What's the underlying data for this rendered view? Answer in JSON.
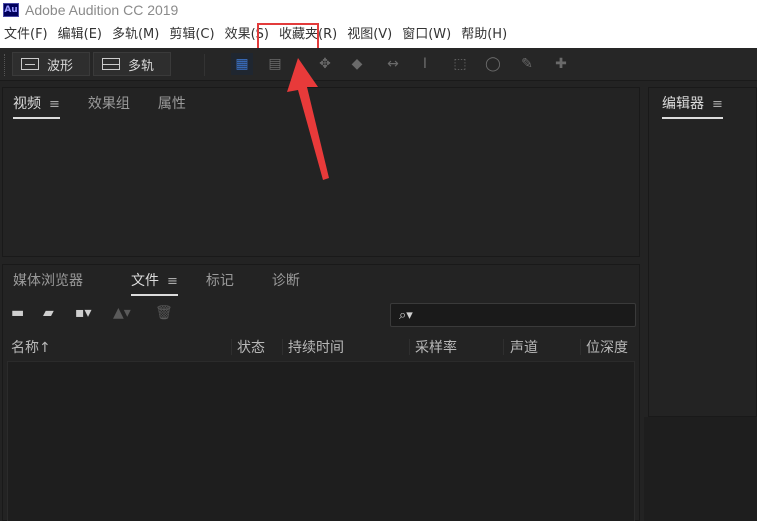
{
  "window": {
    "logo": "Au",
    "title": "Adobe Audition CC 2019"
  },
  "menu": {
    "items": [
      {
        "label": "文件(F)"
      },
      {
        "label": "编辑(E)"
      },
      {
        "label": "多轨(M)"
      },
      {
        "label": "剪辑(C)"
      },
      {
        "label": "效果(S)"
      },
      {
        "label": "收藏夹(R)"
      },
      {
        "label": "视图(V)"
      },
      {
        "label": "窗口(W)"
      },
      {
        "label": "帮助(H)"
      }
    ],
    "highlighted": "效果(S)"
  },
  "toolbar": {
    "waveform_label": "波形",
    "multitrack_label": "多轨"
  },
  "top_panel": {
    "tabs": [
      {
        "label": "视频"
      },
      {
        "label": "效果组"
      },
      {
        "label": "属性"
      }
    ],
    "menu_glyph": "≡"
  },
  "right_panel": {
    "tabs": [
      {
        "label": "编辑器"
      }
    ],
    "menu_glyph": "≡"
  },
  "files_panel": {
    "tabs": [
      {
        "label": "媒体浏览器"
      },
      {
        "label": "文件"
      },
      {
        "label": "标记"
      },
      {
        "label": "诊断"
      }
    ],
    "menu_glyph": "≡",
    "search_placeholder": "",
    "columns": [
      {
        "label": "名称"
      },
      {
        "label": "状态"
      },
      {
        "label": "持续时间"
      },
      {
        "label": "采样率"
      },
      {
        "label": "声道"
      },
      {
        "label": "位深度"
      }
    ],
    "sort_indicator": "↑"
  },
  "colors": {
    "accent": "#3d73c8",
    "highlight_box": "#e23b3b",
    "panel_bg": "#232323"
  }
}
